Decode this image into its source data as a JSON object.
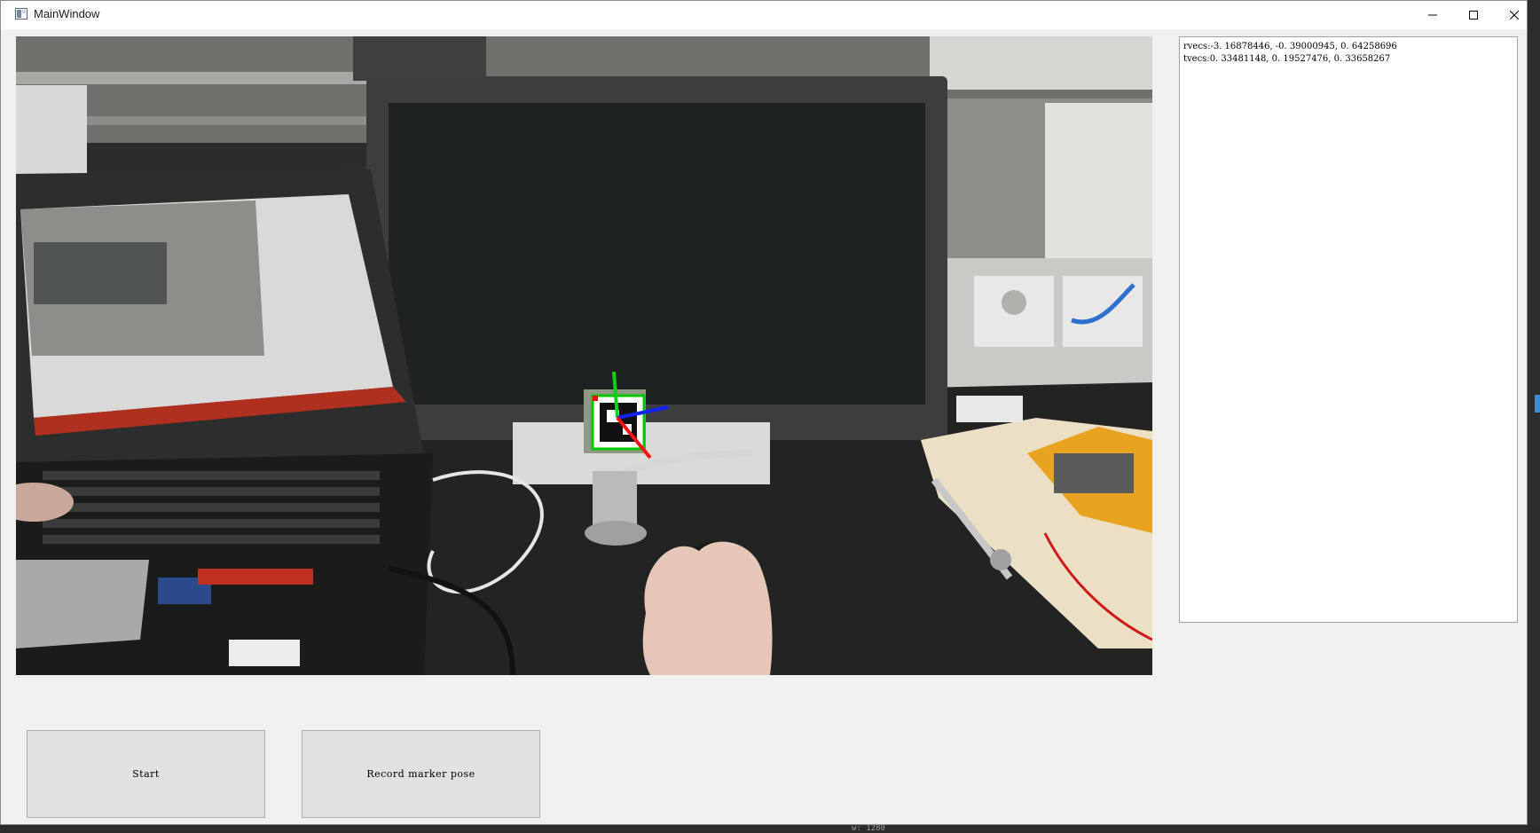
{
  "window": {
    "title": "MainWindow"
  },
  "pose_output": {
    "rvecs": "rvecs:-3. 16878446, -0. 39000945, 0. 64258696",
    "tvecs": "tvecs:0. 33481148, 0. 19527476, 0. 33658267"
  },
  "buttons": {
    "start_label": "Start",
    "record_label": "Record marker pose"
  },
  "status": {
    "width_readout": "w: 1280"
  },
  "icons": {
    "app": "window-app-icon",
    "minimize": "minimize-icon",
    "maximize": "maximize-icon",
    "close": "close-icon"
  },
  "colors": {
    "axis_x": "#ff1010",
    "axis_y": "#10d010",
    "axis_z": "#1020ff",
    "marker_border": "#00c800"
  }
}
